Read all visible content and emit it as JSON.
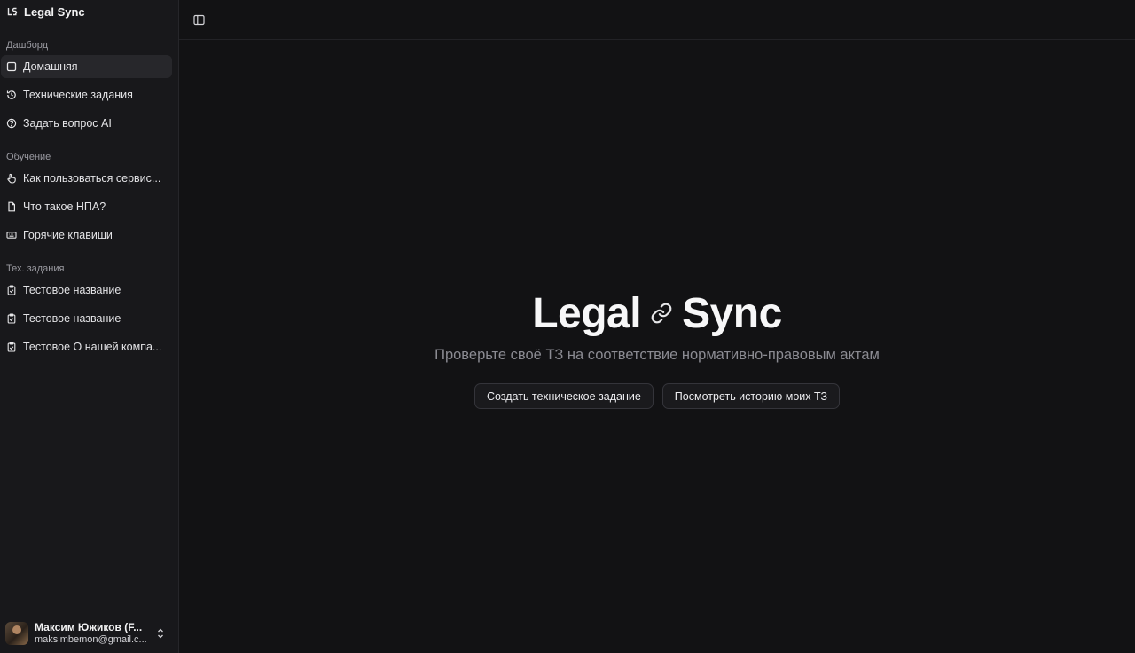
{
  "brand": {
    "name": "Legal Sync"
  },
  "sidebar": {
    "groups": [
      {
        "label": "Дашборд",
        "items": [
          {
            "label": "Домашняя",
            "icon": "square-icon",
            "active": true
          },
          {
            "label": "Технические задания",
            "icon": "history-icon"
          },
          {
            "label": "Задать вопрос AI",
            "icon": "help-circle-icon"
          }
        ]
      },
      {
        "label": "Обучение",
        "items": [
          {
            "label": "Как пользоваться сервис...",
            "icon": "pointer-hand-icon"
          },
          {
            "label": "Что такое НПА?",
            "icon": "file-icon"
          },
          {
            "label": "Горячие клавиши",
            "icon": "keyboard-icon"
          }
        ]
      },
      {
        "label": "Тех. задания",
        "items": [
          {
            "label": "Тестовое название",
            "icon": "clipboard-check-icon"
          },
          {
            "label": "Тестовое название",
            "icon": "clipboard-check-icon"
          },
          {
            "label": "Тестовое О нашей компа...",
            "icon": "clipboard-check-icon"
          }
        ]
      }
    ]
  },
  "user": {
    "name": "Максим Южиков (F...",
    "email": "maksimbemon@gmail.c..."
  },
  "hero": {
    "title_left": "Legal",
    "title_right": "Sync",
    "subtitle": "Проверьте своё ТЗ на соответствие нормативно-правовым актам",
    "primary_button": "Создать техническое задание",
    "secondary_button": "Посмотреть историю моих ТЗ"
  },
  "colors": {
    "background": "#121214",
    "sidebar": "#18181b",
    "active_item": "#27272b",
    "text": "#e4e4e7",
    "muted": "#8b8b92"
  }
}
